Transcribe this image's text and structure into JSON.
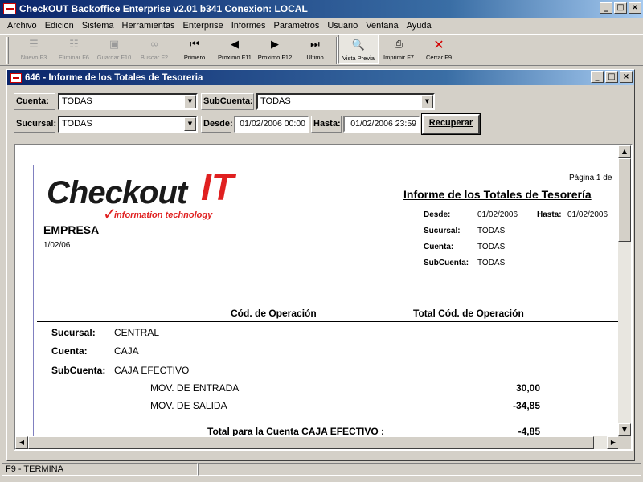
{
  "app": {
    "title": "CheckOUT Backoffice Enterprise v2.01 b341 Conexion: LOCAL"
  },
  "menu": [
    "Archivo",
    "Edicion",
    "Sistema",
    "Herramientas",
    "Enterprise",
    "Informes",
    "Parametros",
    "Usuario",
    "Ventana",
    "Ayuda"
  ],
  "toolbar": {
    "nuevo": "Nuevo F3",
    "eliminar": "Eliminar F6",
    "guardar": "Guardar F10",
    "buscar": "Buscar F2",
    "primero": "Primero",
    "previo": "Proximo F11",
    "proximo": "Proximo F12",
    "ultimo": "Ultimo",
    "vista": "Vista Previa",
    "imprimir": "Imprimir F7",
    "cerrar": "Cerrar F9"
  },
  "child": {
    "title": "646 - Informe de los Totales de Tesoreria"
  },
  "filters": {
    "cuenta_label": "Cuenta:",
    "cuenta_value": "TODAS",
    "subcuenta_label": "SubCuenta:",
    "subcuenta_value": "TODAS",
    "sucursal_label": "Sucursal:",
    "sucursal_value": "TODAS",
    "desde_label": "Desde:",
    "desde_value": "01/02/2006 00:00",
    "hasta_label": "Hasta:",
    "hasta_value": "01/02/2006 23:59",
    "recuperar": "Recuperar"
  },
  "report": {
    "logo_main": "Checkout",
    "logo_it": "IT",
    "logo_sub": "information technology",
    "page": "Página 1 de",
    "title": "Informe de los Totales de Tesorería",
    "empresa": "EMPRESA",
    "fecha": "1/02/06",
    "desde_label": "Desde:",
    "desde_value": "01/02/2006",
    "hasta_label": "Hasta:",
    "hasta_value": "01/02/2006",
    "sucursal_label": "Sucursal:",
    "sucursal_value": "TODAS",
    "cuenta_label": "Cuenta:",
    "cuenta_value": "TODAS",
    "subcuenta_label": "SubCuenta:",
    "subcuenta_value": "TODAS",
    "col_codigo": "Cód. de Operación",
    "col_total": "Total Cód. de Operación",
    "group_sucursal_label": "Sucursal:",
    "group_sucursal_value": "CENTRAL",
    "group_cuenta_label": "Cuenta:",
    "group_cuenta_value": "CAJA",
    "group_subcuenta_label": "SubCuenta:",
    "group_subcuenta_value": "CAJA EFECTIVO",
    "rows": [
      {
        "operacion": "MOV. DE ENTRADA",
        "total": "30,00"
      },
      {
        "operacion": "MOV. DE SALIDA",
        "total": "-34,85"
      }
    ],
    "total_label": "Total para la Cuenta CAJA EFECTIVO :",
    "total_value": "-4,85"
  },
  "status": {
    "text": "F9 - TERMINA"
  }
}
